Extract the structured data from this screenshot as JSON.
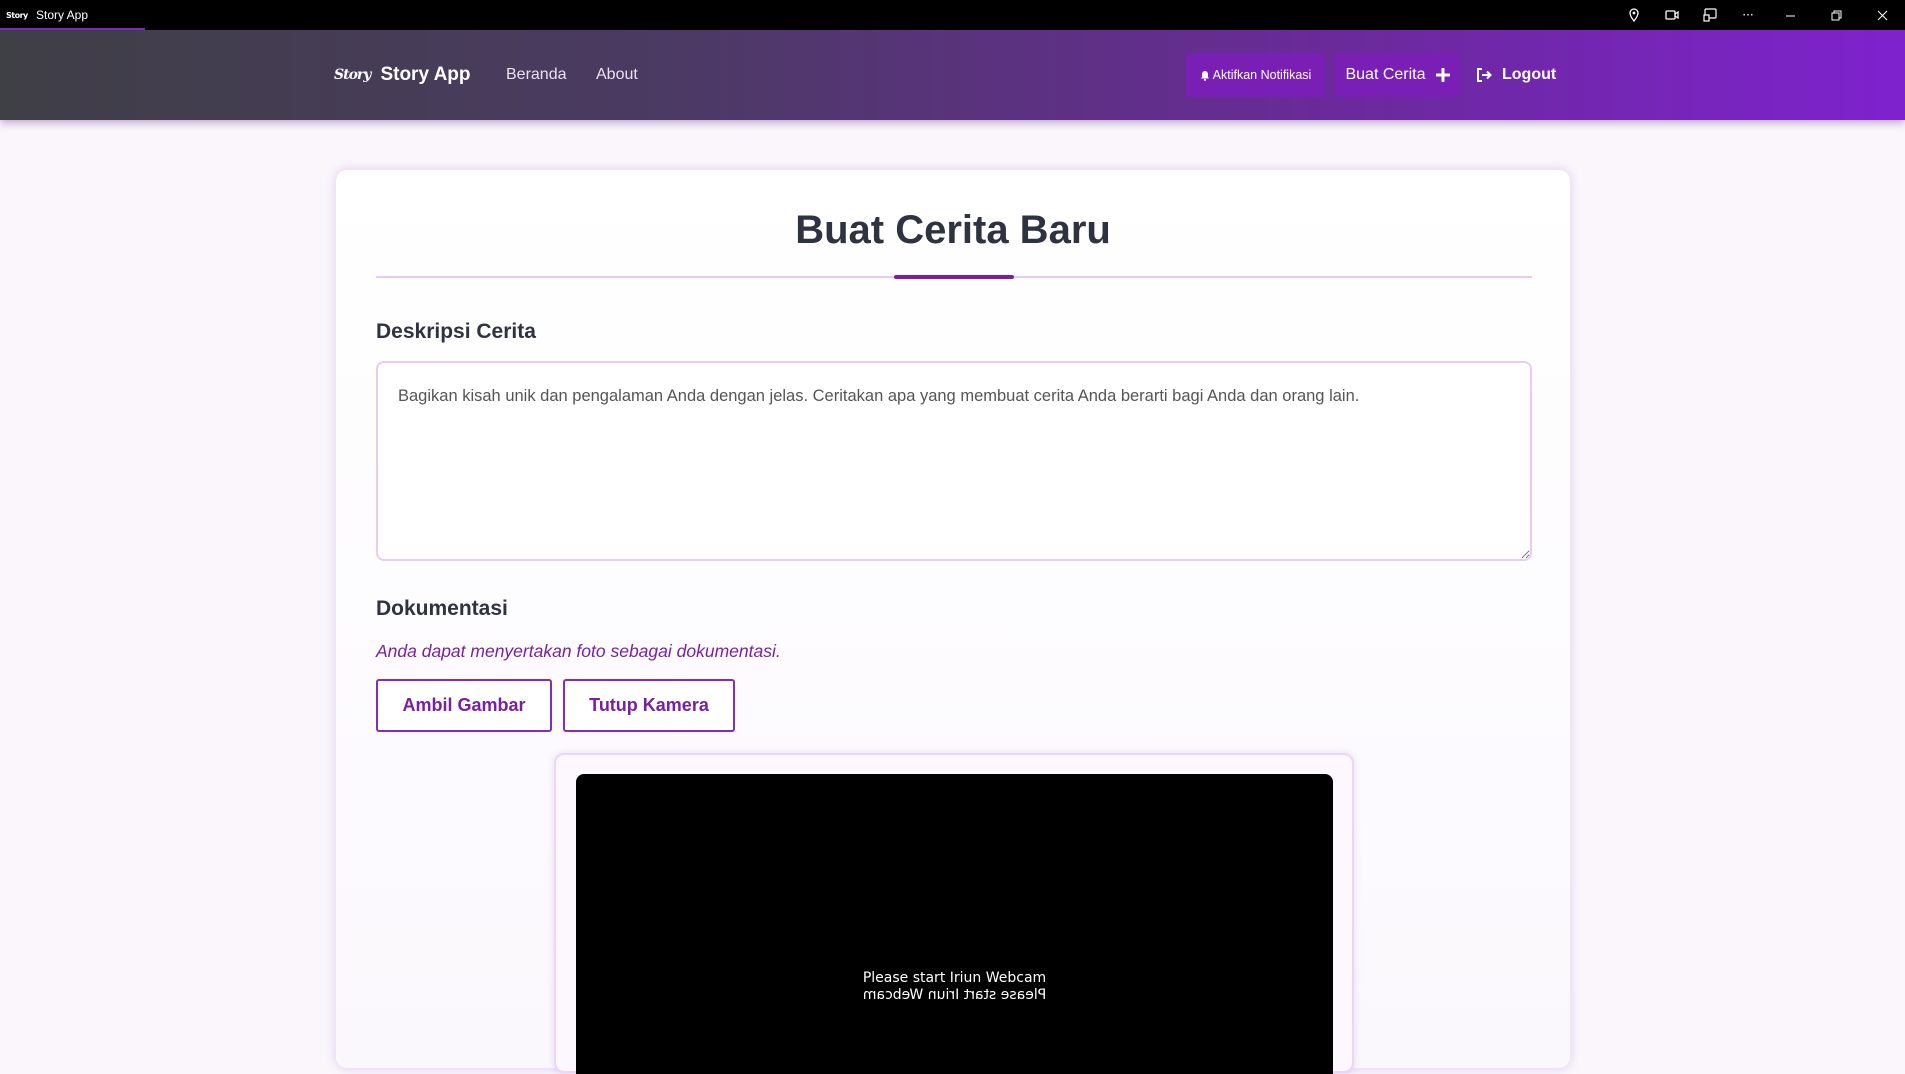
{
  "window": {
    "title": "Story App",
    "icon_text": "Story",
    "controls": [
      "location-icon",
      "camera-icon",
      "cast-icon",
      "more-icon",
      "minimize-icon",
      "restore-icon",
      "close-icon"
    ]
  },
  "navbar": {
    "brand_logo": "Story",
    "brand_name": "Story App",
    "links": {
      "beranda": "Beranda",
      "about": "About"
    },
    "notif_button": "Aktifkan Notifikasi",
    "create_button": "Buat Cerita",
    "logout_button": "Logout"
  },
  "form": {
    "title": "Buat Cerita Baru",
    "description_label": "Deskripsi Cerita",
    "description_value": "Bagikan kisah unik dan pengalaman Anda dengan jelas. Ceritakan apa yang membuat cerita Anda berarti bagi Anda dan orang lain.",
    "documentation_label": "Dokumentasi",
    "documentation_hint": "Anda dapat menyertakan foto sebagai dokumentasi.",
    "take_picture_button": "Ambil Gambar",
    "close_camera_button": "Tutup Kamera",
    "camera_message": "Please start Iriun Webcam",
    "camera_message_mirrored": "Please start Iriun Webcam"
  },
  "colors": {
    "accent": "#7b1fa2",
    "navbar_start": "#3f3f46",
    "navbar_end": "#7e22ce",
    "button_bg": "#7a1fb6"
  }
}
